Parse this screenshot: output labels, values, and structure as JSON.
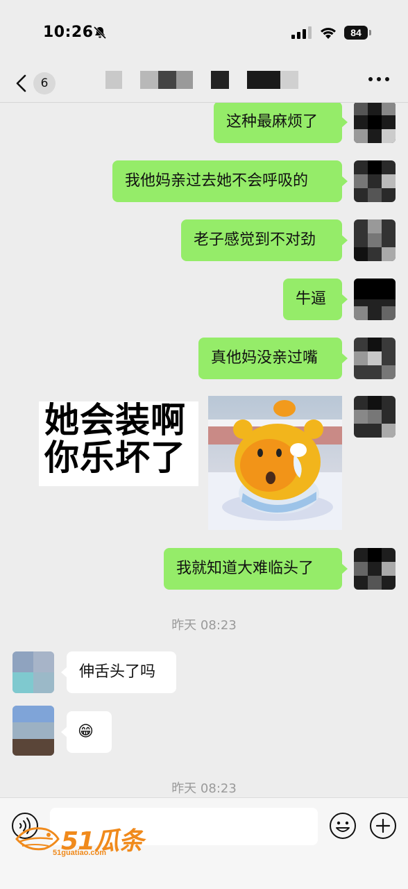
{
  "status_bar": {
    "time": "10:26",
    "battery": "84",
    "icons": [
      "bell-muted-icon",
      "cellular-signal-icon",
      "wifi-icon",
      "battery-icon"
    ]
  },
  "header": {
    "unread_count": "6",
    "icons": [
      "chevron-left-icon",
      "more-dots-icon"
    ]
  },
  "messages": [
    {
      "direction": "out",
      "type": "text",
      "text": "这种最麻烦了"
    },
    {
      "direction": "out",
      "type": "text",
      "text": "我他妈亲过去她不会呼吸的"
    },
    {
      "direction": "out",
      "type": "text",
      "text": "老子感觉到不对劲"
    },
    {
      "direction": "out",
      "type": "text",
      "text": "牛逼"
    },
    {
      "direction": "out",
      "type": "text",
      "text": "真他妈没亲过嘴"
    },
    {
      "direction": "out",
      "type": "sticker",
      "lines": [
        "她会装啊",
        "你乐坏了"
      ]
    },
    {
      "direction": "out",
      "type": "text",
      "text": "我就知道大难临头了"
    },
    {
      "type": "timestamp",
      "text": "昨天 08:23"
    },
    {
      "direction": "in",
      "type": "text",
      "text": "伸舌头了吗"
    },
    {
      "direction": "in",
      "type": "emoji",
      "text": "😁"
    },
    {
      "type": "timestamp",
      "text": "昨天 08:23"
    }
  ],
  "input_bar": {
    "placeholder": "",
    "icons": [
      "voice-icon",
      "emoji-icon",
      "plus-icon"
    ]
  },
  "watermark": {
    "brand": "51瓜条",
    "url": "51guatiao.com"
  },
  "colors": {
    "outgoing_bubble": "#95ec69",
    "incoming_bubble": "#ffffff",
    "background": "#ededed",
    "watermark": "#f08a1c"
  }
}
